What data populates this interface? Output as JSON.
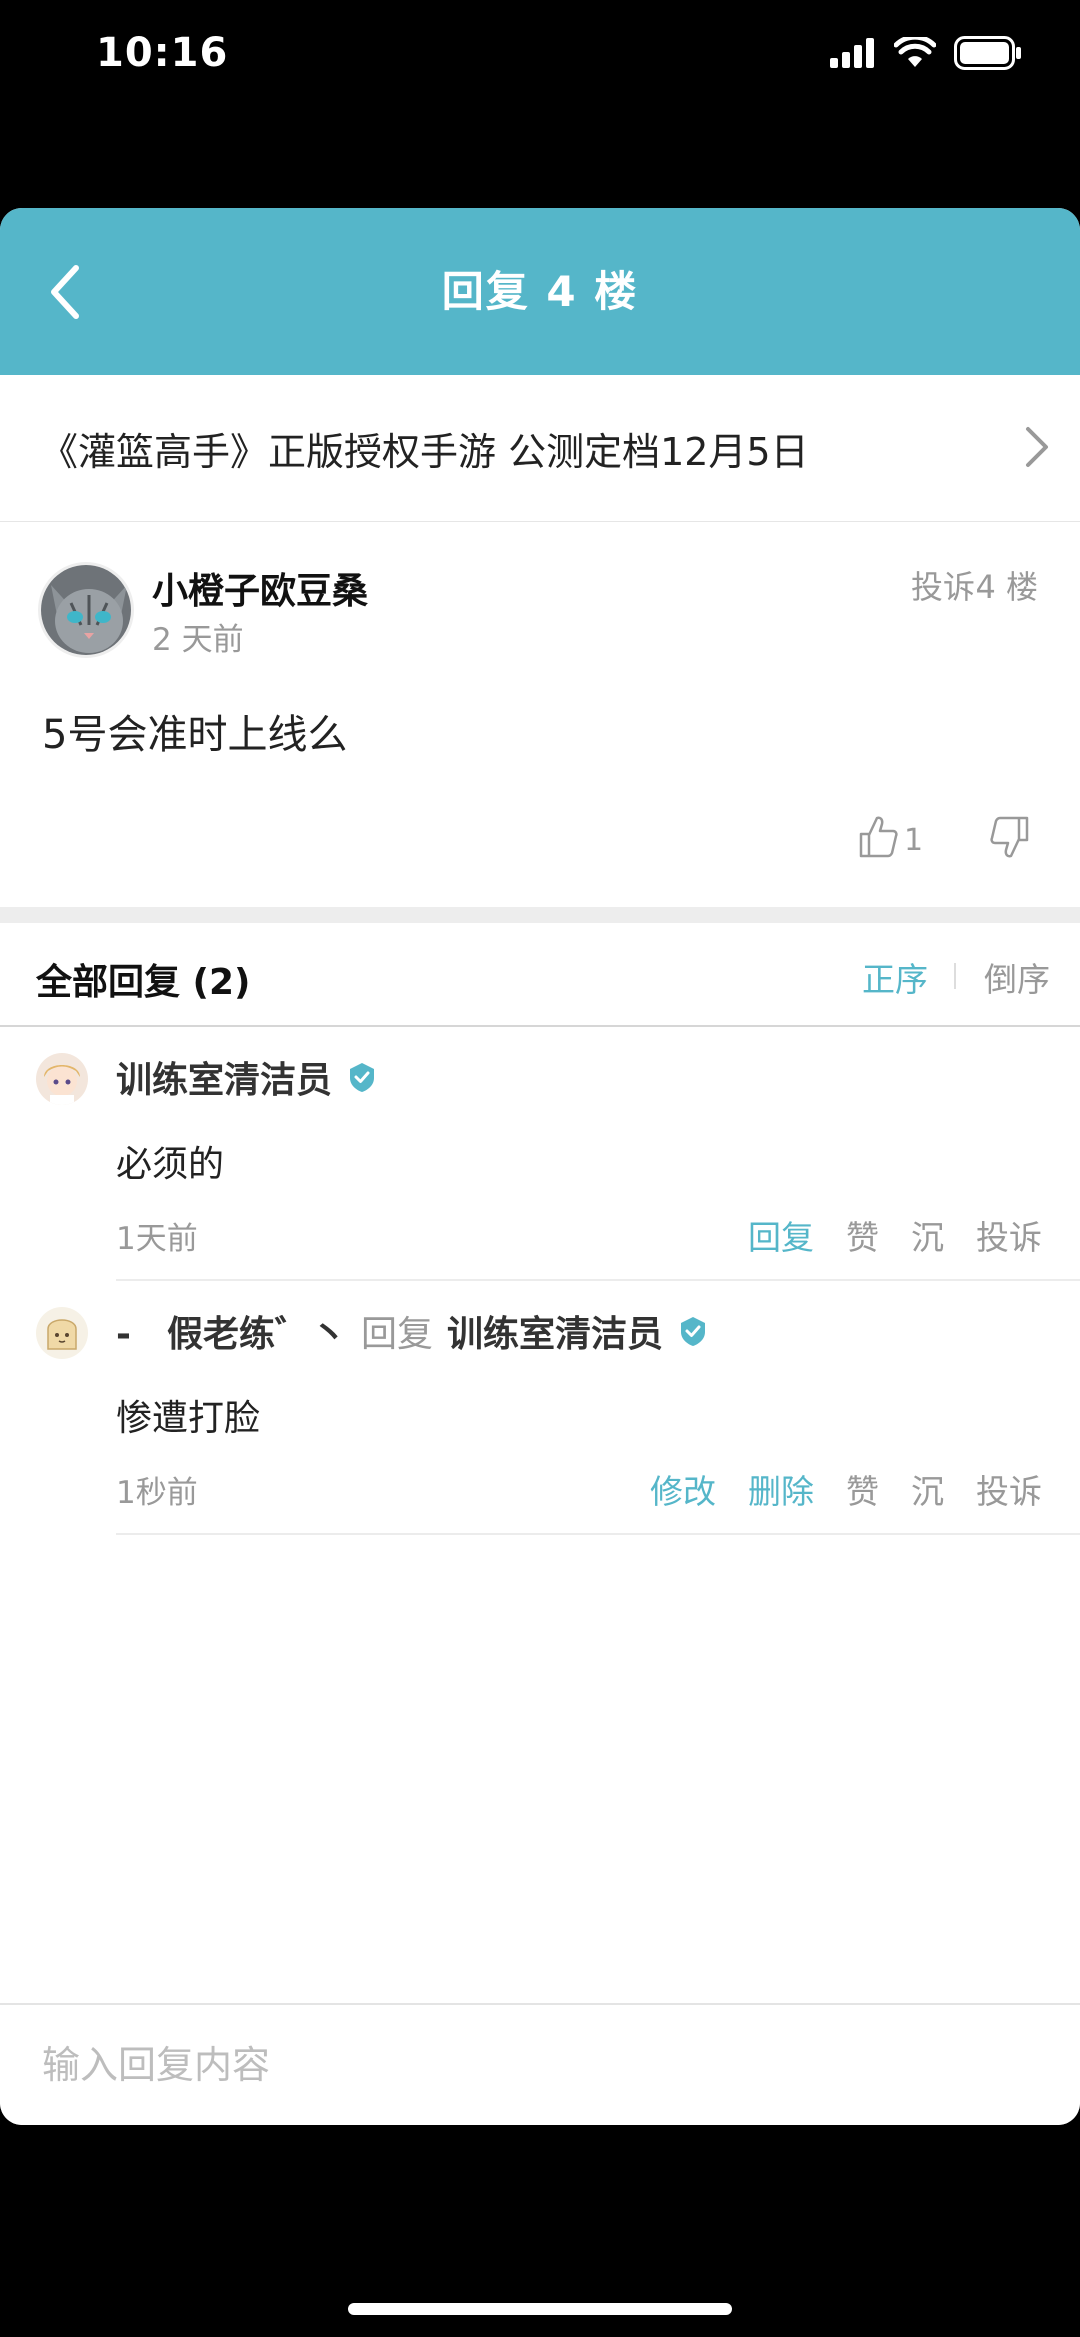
{
  "status_bar": {
    "time": "10:16"
  },
  "nav": {
    "title": "回复 4 楼"
  },
  "topic": {
    "title": "《灌篮高手》正版授权手游 公测定档12月5日"
  },
  "post": {
    "author": "小橙子欧豆桑",
    "time": "2 天前",
    "report_label": "投诉",
    "floor": "4 楼",
    "content": "5号会准时上线么",
    "like_count": "1"
  },
  "replies_header": {
    "title": "全部回复 (2)",
    "sort_asc": "正序",
    "sort_desc": "倒序"
  },
  "replies": [
    {
      "author": "训练室清洁员",
      "content": "必须的",
      "time": "1天前",
      "actions": [
        "回复",
        "赞",
        "沉",
        "投诉"
      ]
    },
    {
      "author": "-　假老练゛丶",
      "reply_word": "回复",
      "reply_target": "训练室清洁员",
      "content": "惨遭打脸",
      "time": "1秒前",
      "actions": [
        "修改",
        "删除",
        "赞",
        "沉",
        "投诉"
      ]
    }
  ],
  "input": {
    "placeholder": "输入回复内容"
  },
  "colors": {
    "accent": "#55b6c9",
    "muted": "#999999"
  },
  "icons": [
    "back-chevron-icon",
    "chevron-right-icon",
    "thumbs-up-icon",
    "thumbs-down-icon",
    "verified-badge-icon",
    "signal-icon",
    "wifi-icon",
    "battery-icon"
  ]
}
